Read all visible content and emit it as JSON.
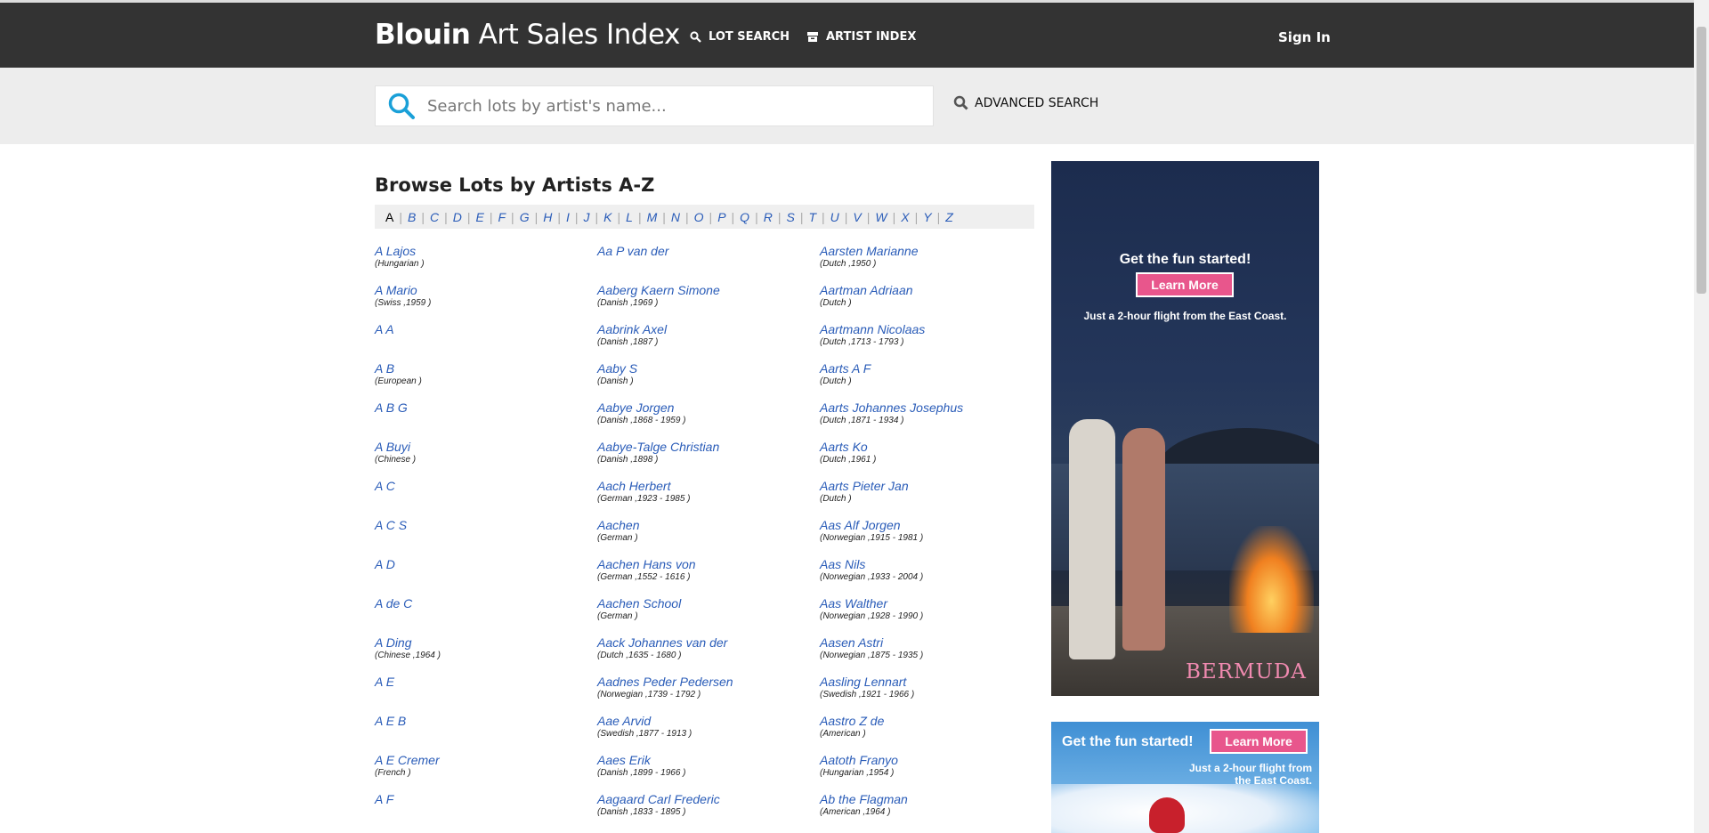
{
  "header": {
    "brand_bold": "Blouin",
    "brand_light": " Art Sales Index",
    "nav": [
      {
        "label": "LOT SEARCH",
        "icon": "search-icon"
      },
      {
        "label": "ARTIST INDEX",
        "icon": "archive-icon"
      }
    ],
    "signin_label": "Sign In"
  },
  "search": {
    "placeholder": "Search lots by artist's name...",
    "value": "",
    "advanced_label": "ADVANCED SEARCH"
  },
  "main": {
    "heading": "Browse Lots by Artists A-Z",
    "letters": [
      "A",
      "B",
      "C",
      "D",
      "E",
      "F",
      "G",
      "H",
      "I",
      "J",
      "K",
      "L",
      "M",
      "N",
      "O",
      "P",
      "Q",
      "R",
      "S",
      "T",
      "U",
      "V",
      "W",
      "X",
      "Y",
      "Z"
    ],
    "active_letter": "A",
    "columns": [
      [
        {
          "name": "A Lajos",
          "meta": "(Hungarian )"
        },
        {
          "name": "A Mario",
          "meta": "(Swiss ,1959 )"
        },
        {
          "name": "A A",
          "meta": ""
        },
        {
          "name": "A B",
          "meta": "(European )"
        },
        {
          "name": "A B G",
          "meta": ""
        },
        {
          "name": "A Buyi",
          "meta": "(Chinese )"
        },
        {
          "name": "A C",
          "meta": ""
        },
        {
          "name": "A C S",
          "meta": ""
        },
        {
          "name": "A D",
          "meta": ""
        },
        {
          "name": "A de C",
          "meta": ""
        },
        {
          "name": "A Ding",
          "meta": "(Chinese ,1964 )"
        },
        {
          "name": "A E",
          "meta": ""
        },
        {
          "name": "A E B",
          "meta": ""
        },
        {
          "name": "A E Cremer",
          "meta": "(French )"
        },
        {
          "name": "A F",
          "meta": ""
        }
      ],
      [
        {
          "name": "Aa P van der",
          "meta": ""
        },
        {
          "name": "Aaberg Kaern Simone",
          "meta": "(Danish ,1969 )"
        },
        {
          "name": "Aabrink Axel",
          "meta": "(Danish ,1887 )"
        },
        {
          "name": "Aaby S",
          "meta": "(Danish )"
        },
        {
          "name": "Aabye Jorgen",
          "meta": "(Danish ,1868 - 1959 )"
        },
        {
          "name": "Aabye-Talge Christian",
          "meta": "(Danish ,1898 )"
        },
        {
          "name": "Aach Herbert",
          "meta": "(German ,1923 - 1985 )"
        },
        {
          "name": "Aachen",
          "meta": "(German )"
        },
        {
          "name": "Aachen Hans von",
          "meta": "(German ,1552 - 1616 )"
        },
        {
          "name": "Aachen School",
          "meta": "(German )"
        },
        {
          "name": "Aack Johannes van der",
          "meta": "(Dutch ,1635 - 1680 )"
        },
        {
          "name": "Aadnes Peder Pedersen",
          "meta": "(Norwegian ,1739 - 1792 )"
        },
        {
          "name": "Aae Arvid",
          "meta": "(Swedish ,1877 - 1913 )"
        },
        {
          "name": "Aaes Erik",
          "meta": "(Danish ,1899 - 1966 )"
        },
        {
          "name": "Aagaard Carl Frederic",
          "meta": "(Danish ,1833 - 1895 )"
        }
      ],
      [
        {
          "name": "Aarsten Marianne",
          "meta": "(Dutch ,1950 )"
        },
        {
          "name": "Aartman Adriaan",
          "meta": "(Dutch )"
        },
        {
          "name": "Aartmann Nicolaas",
          "meta": "(Dutch ,1713 - 1793 )"
        },
        {
          "name": "Aarts A F",
          "meta": "(Dutch )"
        },
        {
          "name": "Aarts Johannes Josephus",
          "meta": "(Dutch ,1871 - 1934 )"
        },
        {
          "name": "Aarts Ko",
          "meta": "(Dutch ,1961 )"
        },
        {
          "name": "Aarts Pieter Jan",
          "meta": "(Dutch )"
        },
        {
          "name": "Aas Alf Jorgen",
          "meta": "(Norwegian ,1915 - 1981 )"
        },
        {
          "name": "Aas Nils",
          "meta": "(Norwegian ,1933 - 2004 )"
        },
        {
          "name": "Aas Walther",
          "meta": "(Norwegian ,1928 - 1990 )"
        },
        {
          "name": "Aasen Astri",
          "meta": "(Norwegian ,1875 - 1935 )"
        },
        {
          "name": "Aasling Lennart",
          "meta": "(Swedish ,1921 - 1966 )"
        },
        {
          "name": "Aastro Z de",
          "meta": "(American )"
        },
        {
          "name": "Aatoth Franyo",
          "meta": "(Hungarian ,1954 )"
        },
        {
          "name": "Ab the Flagman",
          "meta": "(American ,1964 )"
        }
      ]
    ]
  },
  "ads": {
    "ad1": {
      "headline": "Get the fun started!",
      "button": "Learn More",
      "tagline": "Just a 2-hour flight from the East Coast.",
      "brand": "BERMUDA"
    },
    "ad2": {
      "headline": "Get the fun started!",
      "button": "Learn More",
      "tagline": "Just a 2-hour flight from the East Coast."
    }
  },
  "colors": {
    "topbar": "#333333",
    "link": "#2a5cb8",
    "search_icon": "#1aa0d8",
    "ad_button": "#e8568c"
  }
}
